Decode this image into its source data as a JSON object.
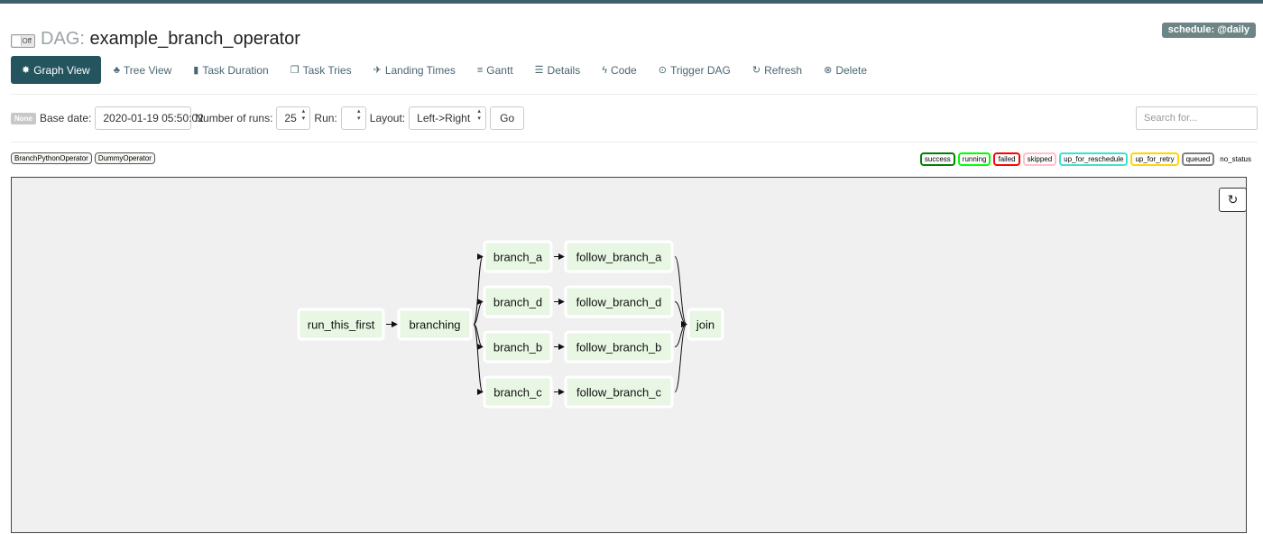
{
  "header": {
    "toggle_label": "Off",
    "dag_prefix": "DAG:",
    "dag_name": "example_branch_operator",
    "schedule": "schedule: @daily"
  },
  "nav": [
    {
      "label": "Graph View",
      "icon": "✸",
      "icon_name": "graph-icon",
      "active": true
    },
    {
      "label": "Tree View",
      "icon": "♣",
      "icon_name": "tree-icon"
    },
    {
      "label": "Task Duration",
      "icon": "▮",
      "icon_name": "bar-chart-icon"
    },
    {
      "label": "Task Tries",
      "icon": "❐",
      "icon_name": "task-tries-icon"
    },
    {
      "label": "Landing Times",
      "icon": "✈",
      "icon_name": "plane-icon"
    },
    {
      "label": "Gantt",
      "icon": "≡",
      "icon_name": "gantt-icon"
    },
    {
      "label": "Details",
      "icon": "☰",
      "icon_name": "list-icon"
    },
    {
      "label": "Code",
      "icon": "ϟ",
      "icon_name": "bolt-icon"
    },
    {
      "label": "Trigger DAG",
      "icon": "⊙",
      "icon_name": "play-circle-icon"
    },
    {
      "label": "Refresh",
      "icon": "↻",
      "icon_name": "refresh-icon"
    },
    {
      "label": "Delete",
      "icon": "⊗",
      "icon_name": "delete-circle-icon"
    }
  ],
  "form": {
    "none_badge": "None",
    "base_date_label": "Base date:",
    "base_date_value": "2020-01-19 05:50:02",
    "num_runs_label": "Number of runs:",
    "num_runs_value": "25",
    "run_label": "Run:",
    "run_value": "",
    "layout_label": "Layout:",
    "layout_value": "Left->Right",
    "go_label": "Go",
    "search_placeholder": "Search for..."
  },
  "operators": [
    "BranchPythonOperator",
    "DummyOperator"
  ],
  "statuses": [
    {
      "label": "success",
      "color": "#008000"
    },
    {
      "label": "running",
      "color": "#00ff00"
    },
    {
      "label": "failed",
      "color": "#ff0000"
    },
    {
      "label": "skipped",
      "color": "#ffc0cb"
    },
    {
      "label": "up_for_reschedule",
      "color": "#40e0d0"
    },
    {
      "label": "up_for_retry",
      "color": "#ffd700"
    },
    {
      "label": "queued",
      "color": "#808080"
    },
    {
      "label": "no_status",
      "color": null
    }
  ],
  "graph": {
    "refresh_icon": "↻",
    "node_fill": "#e8f7e4",
    "node_stroke": "#ffffff",
    "nodes": [
      {
        "id": "run_this_first",
        "label": "run_this_first"
      },
      {
        "id": "branching",
        "label": "branching"
      },
      {
        "id": "branch_a",
        "label": "branch_a"
      },
      {
        "id": "branch_d",
        "label": "branch_d"
      },
      {
        "id": "branch_b",
        "label": "branch_b"
      },
      {
        "id": "branch_c",
        "label": "branch_c"
      },
      {
        "id": "follow_branch_a",
        "label": "follow_branch_a"
      },
      {
        "id": "follow_branch_d",
        "label": "follow_branch_d"
      },
      {
        "id": "follow_branch_b",
        "label": "follow_branch_b"
      },
      {
        "id": "follow_branch_c",
        "label": "follow_branch_c"
      },
      {
        "id": "join",
        "label": "join"
      }
    ],
    "edges": [
      [
        "run_this_first",
        "branching"
      ],
      [
        "branching",
        "branch_a"
      ],
      [
        "branching",
        "branch_d"
      ],
      [
        "branching",
        "branch_b"
      ],
      [
        "branching",
        "branch_c"
      ],
      [
        "branch_a",
        "follow_branch_a"
      ],
      [
        "branch_d",
        "follow_branch_d"
      ],
      [
        "branch_b",
        "follow_branch_b"
      ],
      [
        "branch_c",
        "follow_branch_c"
      ],
      [
        "follow_branch_a",
        "join"
      ],
      [
        "follow_branch_d",
        "join"
      ],
      [
        "follow_branch_b",
        "join"
      ],
      [
        "follow_branch_c",
        "join"
      ]
    ]
  }
}
